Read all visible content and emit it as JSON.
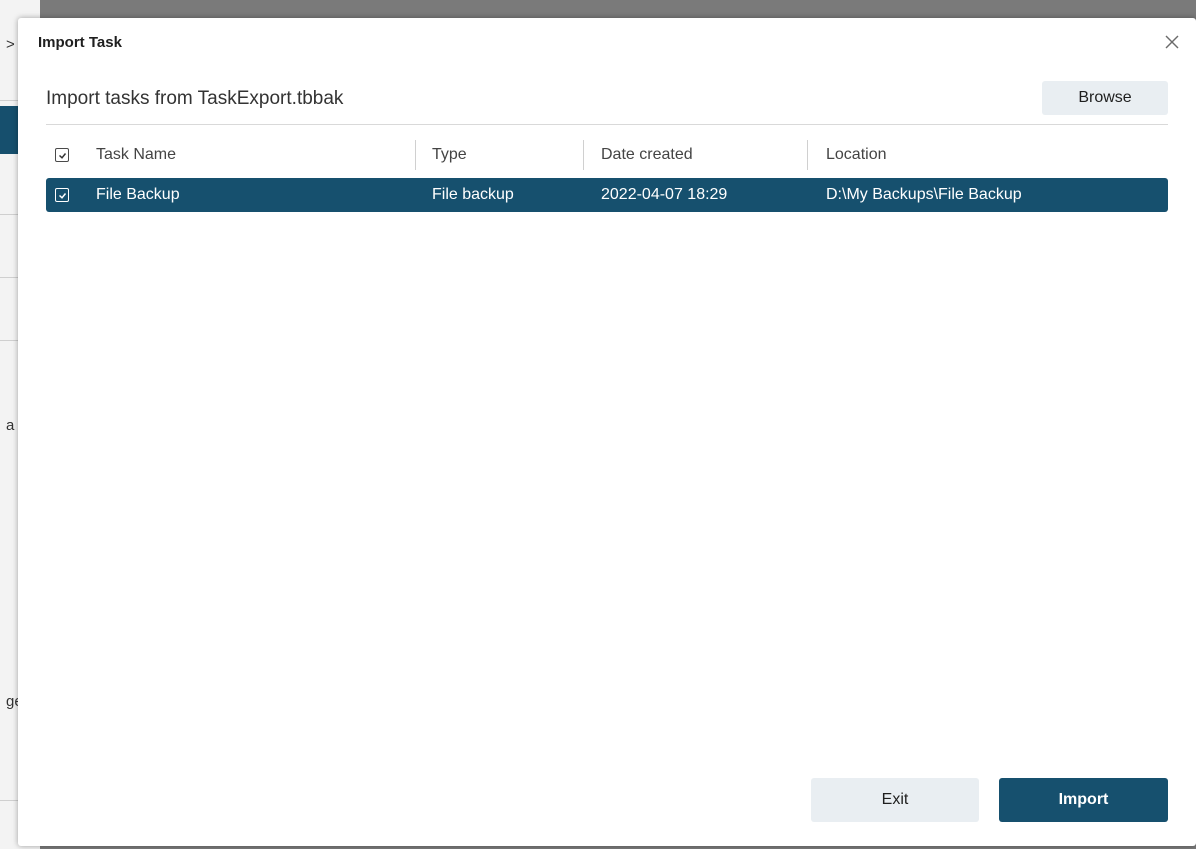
{
  "background_app": {
    "fragments": [
      ">",
      "a",
      "ge"
    ]
  },
  "dialog": {
    "title": "Import Task",
    "close_icon": "close-icon",
    "subheader": "Import tasks from TaskExport.tbbak",
    "browse_label": "Browse",
    "exit_label": "Exit",
    "import_label": "Import"
  },
  "table": {
    "columns": [
      "Task Name",
      "Type",
      "Date created",
      "Location"
    ],
    "header_checked": true,
    "rows": [
      {
        "checked": true,
        "selected": true,
        "name": "File Backup",
        "type": "File backup",
        "date": "2022-04-07 18:29",
        "location": "D:\\My Backups\\File Backup"
      }
    ]
  },
  "colors": {
    "accent": "#16506e",
    "secondary_button": "#e9eef2"
  }
}
